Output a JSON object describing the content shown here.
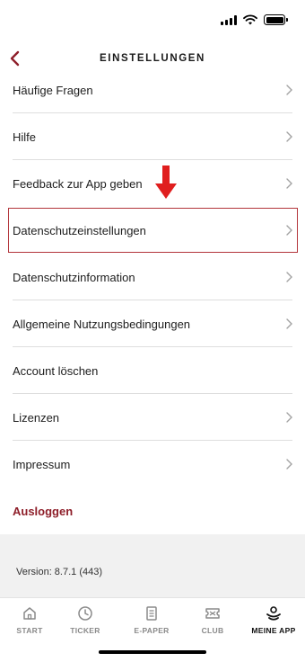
{
  "status_bar": {
    "icons": [
      "signal-icon",
      "wifi-icon",
      "battery-icon"
    ]
  },
  "header": {
    "title": "EINSTELLUNGEN",
    "back_icon": "chevron-left-icon"
  },
  "settings": {
    "items": [
      {
        "label": "Häufige Fragen",
        "chevron": true
      },
      {
        "label": "Hilfe",
        "chevron": true
      },
      {
        "label": "Feedback zur App geben",
        "chevron": true
      },
      {
        "label": "Datenschutzeinstellungen",
        "chevron": true,
        "highlighted": true
      },
      {
        "label": "Datenschutzinformation",
        "chevron": true
      },
      {
        "label": "Allgemeine Nutzungsbedingungen",
        "chevron": true
      },
      {
        "label": "Account löschen",
        "chevron": false
      },
      {
        "label": "Lizenzen",
        "chevron": true
      },
      {
        "label": "Impressum",
        "chevron": true
      }
    ],
    "logout_label": "Ausloggen"
  },
  "annotation": {
    "arrow_color": "#e01e1e",
    "highlight_color": "#b3353b"
  },
  "version": {
    "text": "Version: 8.7.1 (443)"
  },
  "tab_bar": {
    "tabs": [
      {
        "label": "START",
        "icon": "home-icon",
        "active": false
      },
      {
        "label": "TICKER",
        "icon": "clock-icon",
        "active": false
      },
      {
        "label": "E-PAPER",
        "icon": "document-icon",
        "active": false
      },
      {
        "label": "CLUB",
        "icon": "ticket-icon",
        "active": false
      },
      {
        "label": "MEINE APP",
        "icon": "user-icon",
        "active": true
      }
    ]
  },
  "colors": {
    "accent": "#8e1f2a",
    "text": "#1d1d1d",
    "divider": "#dedede",
    "footer_bg": "#f1f1f1"
  }
}
